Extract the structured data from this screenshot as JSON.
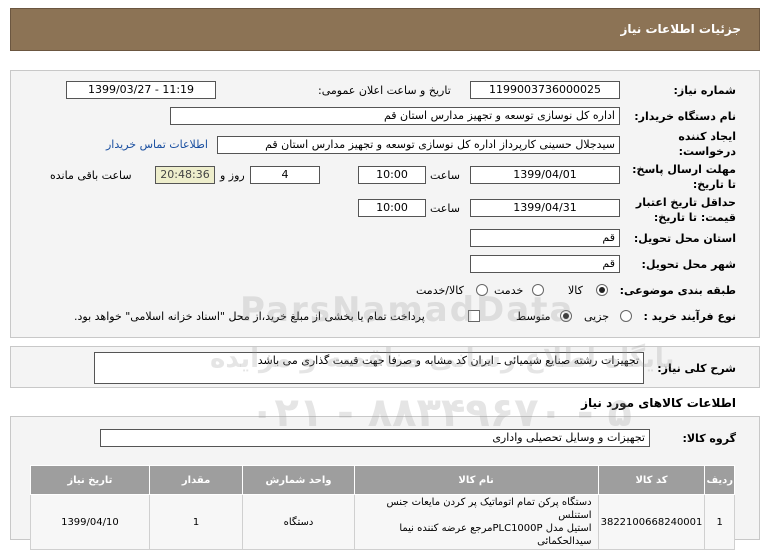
{
  "page": {
    "title": "جزئیات اطلاعات نیاز"
  },
  "fields": {
    "need_number_label": "شماره نیاز:",
    "need_number": "1199003736000025",
    "announce_label": "تاریخ و ساعت اعلان عمومی:",
    "announce_value": "1399/03/27 - 11:19",
    "buyer_org_label": "نام دستگاه خریدار:",
    "buyer_org": "اداره کل نوسازی توسعه و تجهیز مدارس استان قم",
    "requester_label_1": "ایجاد کننده",
    "requester_label_2": "درخواست:",
    "requester": "سیدجلال حسینی کارپرداز اداره کل نوسازی توسعه و تجهیز مدارس استان قم",
    "contact_link": "اطلاعات تماس خریدار",
    "deadline_label_1": "مهلت ارسال پاسخ:",
    "deadline_label_2": "تا تاریخ:",
    "deadline_date": "1399/04/01",
    "time_label": "ساعت",
    "deadline_time": "10:00",
    "days_value": "4",
    "days_label": "روز و",
    "remaining_timer": "20:48:36",
    "remaining_label": "ساعت باقی مانده",
    "validity_label_1": "حداقل تاریخ اعتبار",
    "validity_label_2": "قیمت: تا تاریخ:",
    "validity_date": "1399/04/31",
    "validity_time": "10:00",
    "province_label": "استان محل تحویل:",
    "province": "قم",
    "city_label": "شهر محل تحویل:",
    "city": "قم",
    "category_label": "طبقه بندی موضوعی:",
    "category_options": [
      "کالا",
      "خدمت",
      "کالا/خدمت"
    ],
    "process_label": "نوع فرآیند خرید :",
    "process_options": [
      "جزیی",
      "متوسط"
    ],
    "payment_note": "پرداخت تمام یا بخشی از مبلغ خرید،از محل \"اسناد خزانه اسلامی\" خواهد بود."
  },
  "description": {
    "label": "شرح کلی نیاز:",
    "text": "تجهیزات رشته صنایع شیمیائی ـ ایران کد مشابه و صرفا جهت قیمت گذاری می باشد"
  },
  "goods": {
    "section_title": "اطلاعات کالاهای مورد نیاز",
    "group_label": "گروه کالا:",
    "group_value": "تجهیزات و وسایل تحصیلی واداری",
    "columns": [
      "ردیف",
      "کد کالا",
      "نام کالا",
      "واحد شمارش",
      "مقدار",
      "تاریخ نیاز"
    ],
    "rows": [
      {
        "index": "1",
        "code": "3822100668240001",
        "name_1": "دستگاه پرکن تمام اتوماتیک پر کردن مایعات جنس استنلس",
        "name_2": "استیل مدل PLC1000Pمرجع عرضه کننده نیما",
        "name_3": "سیدالحکمائی",
        "unit": "دستگاه",
        "qty": "1",
        "date": "1399/04/10"
      }
    ]
  },
  "watermark": {
    "brand": "ParsNamadData",
    "line1": "پایگاه اطلاع رسانی مناقصه و مزایده",
    "phone": "۰۲۱ - ۸۸۳۴۹۶۷۰ - ۵"
  }
}
